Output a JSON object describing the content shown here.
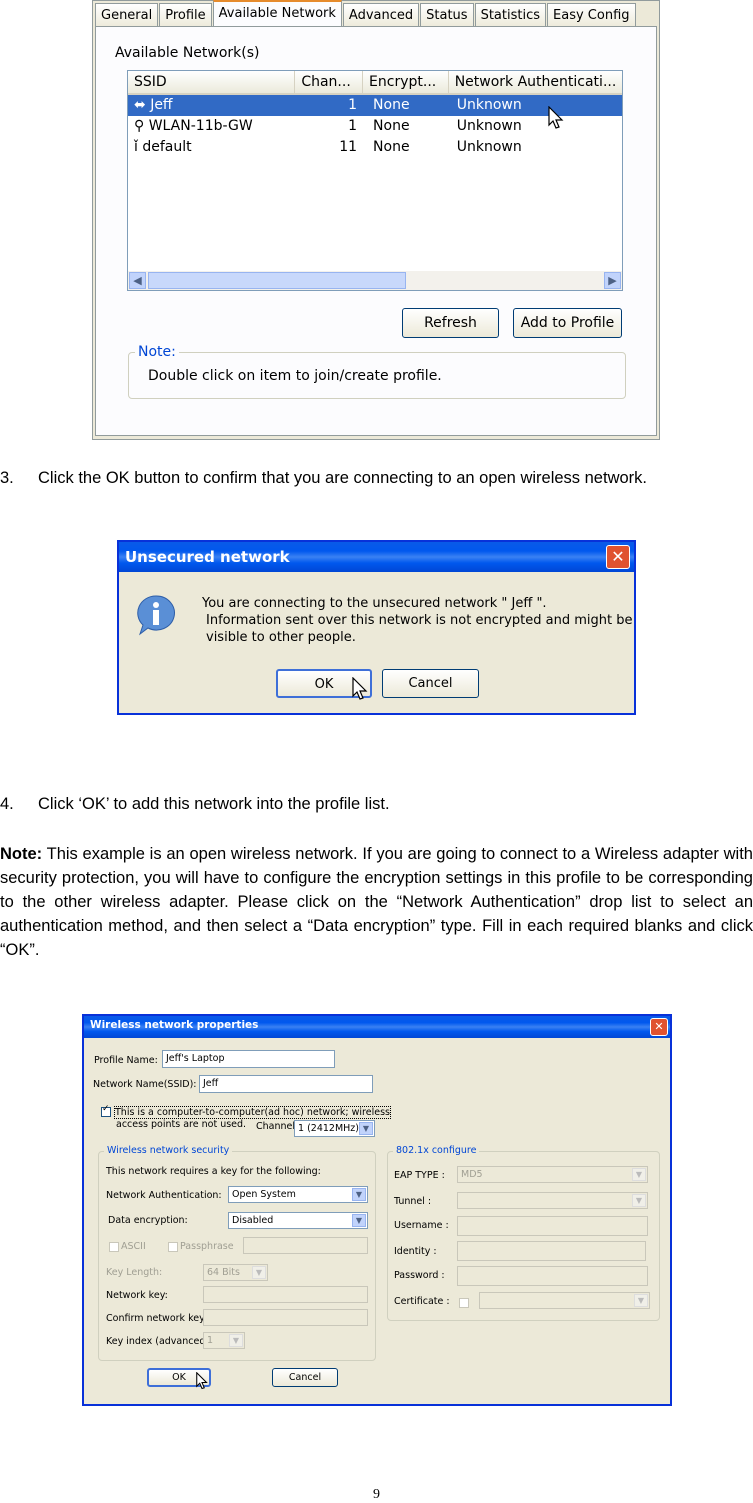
{
  "shot1": {
    "tabs": [
      "General",
      "Profile",
      "Available Network",
      "Advanced",
      "Status",
      "Statistics",
      "Easy Config"
    ],
    "section_label": "Available Network(s)",
    "columns": [
      "SSID",
      "Chan...",
      "Encrypt...",
      "Network Authenticati..."
    ],
    "rows": [
      {
        "ssid": "Jeff",
        "chan": "1",
        "enc": "None",
        "auth": "Unknown"
      },
      {
        "ssid": "WLAN-11b-GW",
        "chan": "1",
        "enc": "None",
        "auth": "Unknown"
      },
      {
        "ssid": "default",
        "chan": "11",
        "enc": "None",
        "auth": "Unknown"
      }
    ],
    "refresh": "Refresh",
    "add_profile": "Add to Profile",
    "note_title": "Note:",
    "note_text": "Double click on item to join/create profile."
  },
  "step3": {
    "num": "3.",
    "text": "Click the OK button to confirm that you are connecting to an open wireless network."
  },
  "shot2": {
    "title": "Unsecured network",
    "line1": "You are connecting to the unsecured network \" Jeff \".",
    "line2": "Information sent over this network is not encrypted and might be",
    "line3": "visible to other people.",
    "ok": "OK",
    "cancel": "Cancel"
  },
  "step4": {
    "num": "4.",
    "text": "Click ‘OK’ to add this network into the profile list."
  },
  "note": {
    "label": "Note:",
    "text": " This example is an open wireless network. If you are going to connect to a Wireless adapter with security protection, you will have to configure the encryption settings in this profile to be corresponding to the other wireless adapter. Please click on the “Network Authentication” drop list to select an authentication method, and then select a “Data encryption” type. Fill in each required blanks and click “OK”."
  },
  "shot3": {
    "title": "Wireless network properties",
    "profile_name_label": "Profile Name:",
    "profile_name": "Jeff's Laptop",
    "ssid_label": "Network Name(SSID):",
    "ssid": "Jeff",
    "adhoc_line1": "This is a computer-to-computer(ad hoc) network; wireless",
    "adhoc_line2": "access points are not used.",
    "channel_label": "Channel",
    "channel": "1  (2412MHz)",
    "wns_title": "Wireless network security",
    "requires_key": "This network requires a key for the following:",
    "auth_label": "Network Authentication:",
    "auth": "Open System",
    "enc_label": "Data encryption:",
    "enc": "Disabled",
    "ascii": "ASCII",
    "passphrase": "Passphrase",
    "key_length_label": "Key Length:",
    "key_length": "64 Bits",
    "network_key_label": "Network key:",
    "confirm_key_label": "Confirm network key:",
    "key_index_label": "Key index (advanced):",
    "key_index": "1",
    "dot1x_title": "802.1x configure",
    "eap_label": "EAP TYPE :",
    "eap": "MD5",
    "tunnel_label": "Tunnel :",
    "username_label": "Username :",
    "identity_label": "Identity :",
    "password_label": "Password :",
    "certificate_label": "Certificate :",
    "ok": "OK",
    "cancel": "Cancel"
  },
  "page_number": "9"
}
